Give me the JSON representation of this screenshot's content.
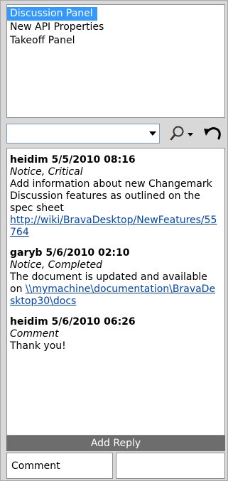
{
  "panels": {
    "items": [
      {
        "label": "Discussion Panel",
        "selected": true
      },
      {
        "label": "New API Properties",
        "selected": false
      },
      {
        "label": "Takeoff Panel",
        "selected": false
      }
    ]
  },
  "toolbar": {
    "filter_value": "",
    "icons": [
      "dropdown-arrow-icon",
      "search-icon",
      "undo-icon"
    ]
  },
  "comments": [
    {
      "author": "heidim",
      "datetime": "5/5/2010 08:16",
      "status": "Notice, Critical",
      "body": "Add information about new Changemark Discussion features as outlined on the spec sheet",
      "link": "http://wiki/BravaDesktop/NewFeatures/55764"
    },
    {
      "author": "garyb",
      "datetime": "5/6/2010 02:10",
      "status": "Notice, Completed",
      "body": "The document is updated and available on ",
      "link": "\\\\mymachine\\documentation\\BravaDesktop30\\docs"
    },
    {
      "author": "heidim",
      "datetime": "5/6/2010 06:26",
      "status": "Comment",
      "body": "Thank you!"
    }
  ],
  "reply": {
    "add_reply_label": "Add Reply",
    "type_label": "Comment"
  },
  "colors": {
    "selection": "#3399ff",
    "link": "#0645ad",
    "reply_bar": "#6d6d6d"
  }
}
